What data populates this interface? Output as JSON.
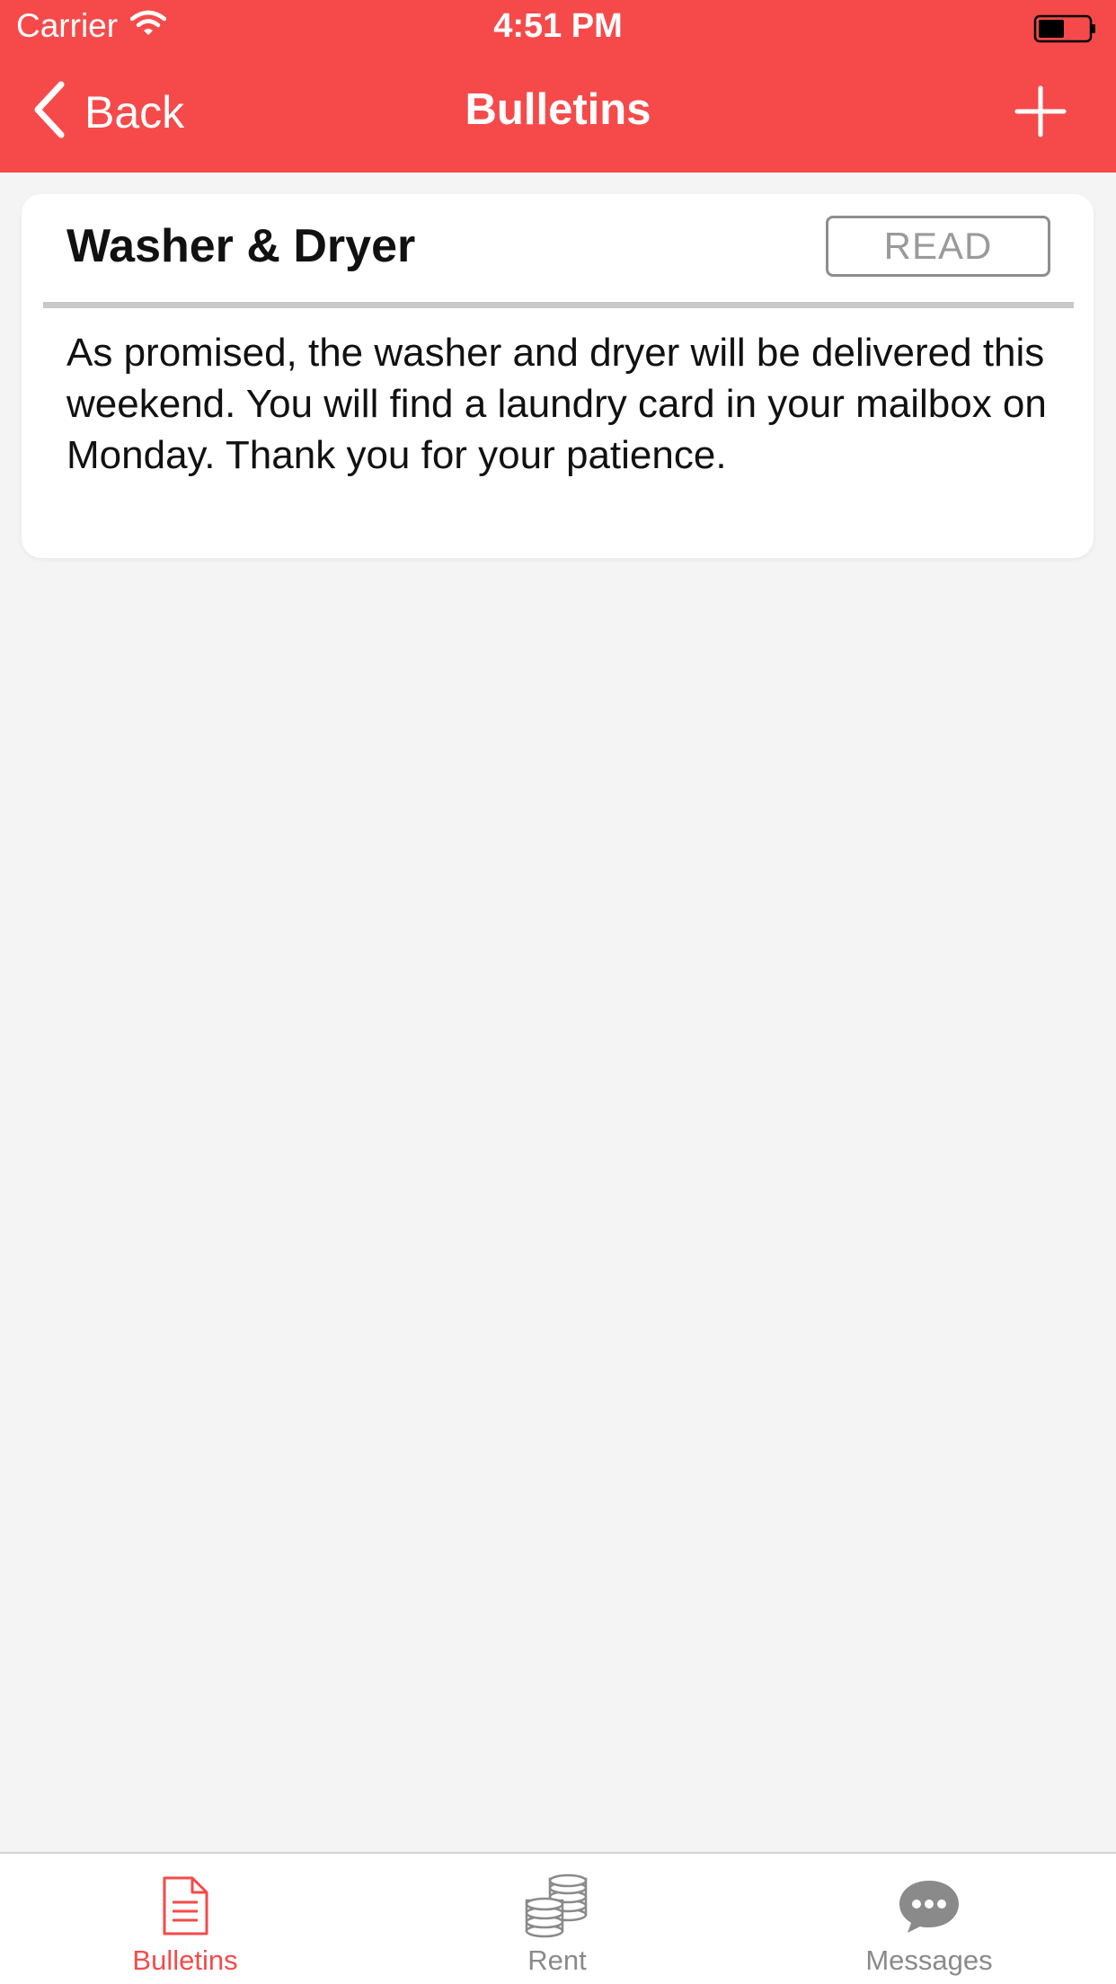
{
  "status_bar": {
    "carrier": "Carrier",
    "time": "4:51 PM"
  },
  "nav": {
    "back_label": "Back",
    "title": "Bulletins",
    "add_icon": "plus-icon"
  },
  "bulletins": [
    {
      "title": "Washer & Dryer",
      "button_label": "READ",
      "body": "As promised, the washer and dryer will be delivered this weekend. You will find a laundry card in your mailbox on Monday. Thank you for your patience."
    }
  ],
  "tabs": [
    {
      "label": "Bulletins",
      "icon": "document-icon",
      "active": true
    },
    {
      "label": "Rent",
      "icon": "coins-icon",
      "active": false
    },
    {
      "label": "Messages",
      "icon": "chat-bubble-icon",
      "active": false
    }
  ],
  "colors": {
    "accent": "#f64a4a",
    "background": "#f4f4f4",
    "inactive": "#8a8a8a"
  }
}
